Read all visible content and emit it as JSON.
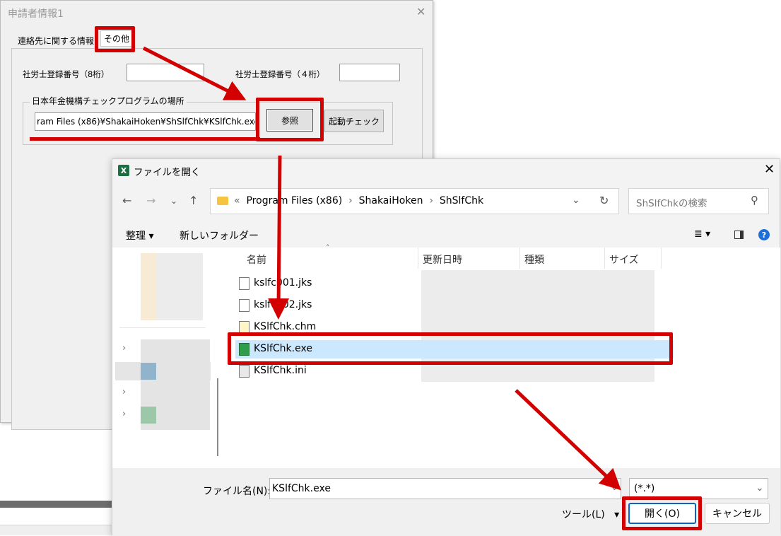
{
  "back_dialog": {
    "title": "申請者情報1",
    "tabs": [
      {
        "label": "連絡先に関する情報"
      },
      {
        "label": "その他"
      }
    ],
    "field1_label": "社労士登録番号（8桁）",
    "field2_label": "社労士登録番号（４桁）",
    "group_title": "日本年金機構チェックプログラムの場所",
    "path_value": "ram Files (x86)¥ShakaiHoken¥ShSlfChk¥KSlfChk.exe",
    "browse_label": "参照",
    "launch_check_label": "起動チェック"
  },
  "file_dialog": {
    "title": "ファイルを開く",
    "address": {
      "chevron": "«",
      "segments": [
        "Program Files (x86)",
        "ShakaiHoken",
        "ShSlfChk"
      ]
    },
    "search_placeholder": "ShSlfChkの検索",
    "toolbar": {
      "organize": "整理 ▾",
      "new_folder": "新しいフォルダー"
    },
    "columns": [
      "名前",
      "更新日時",
      "種類",
      "サイズ"
    ],
    "files": [
      {
        "name": "kslfc001.jks"
      },
      {
        "name": "kslfc002.jks"
      },
      {
        "name": "KSlfChk.chm"
      },
      {
        "name": "KSlfChk.exe"
      },
      {
        "name": "KSlfChk.ini"
      }
    ],
    "filename_label": "ファイル名(N):",
    "filename_value": "KSlfChk.exe",
    "filter_value": "(*.*)",
    "tools_label": "ツール(L)",
    "open_label": "開く(O)",
    "cancel_label": "キャンセル"
  },
  "colors": {
    "annotation": "#d20000",
    "selection": "#cce8ff",
    "accent": "#0b63c3"
  },
  "icons": [
    "close-icon",
    "excel-icon",
    "back-arrow-icon",
    "forward-arrow-icon",
    "up-arrow-icon",
    "folder-icon",
    "refresh-icon",
    "search-icon",
    "view-icon",
    "preview-pane-icon",
    "help-icon",
    "file-icon",
    "exe-icon",
    "chm-icon",
    "ini-icon"
  ]
}
